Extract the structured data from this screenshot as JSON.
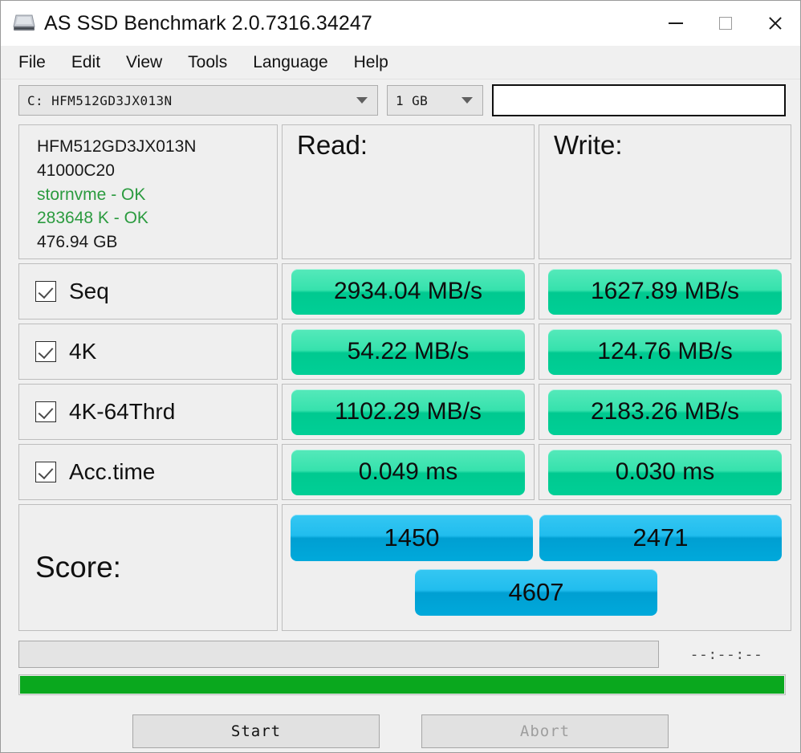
{
  "window": {
    "title": "AS SSD Benchmark 2.0.7316.34247",
    "icon": "ssd-drive-icon",
    "minimize": "minimize-icon",
    "maximize": "maximize-icon",
    "close": "close-icon"
  },
  "menu": {
    "items": [
      "File",
      "Edit",
      "View",
      "Tools",
      "Language",
      "Help"
    ]
  },
  "toolbar": {
    "drive": "C: HFM512GD3JX013N",
    "size": "1 GB",
    "info_field_value": ""
  },
  "drive_info": {
    "model": "HFM512GD3JX013N",
    "firmware": "41000C20",
    "driver": "stornvme - OK",
    "alignment": "283648 K - OK",
    "capacity": "476.94 GB"
  },
  "columns": {
    "read": "Read:",
    "write": "Write:"
  },
  "tests": [
    {
      "name": "Seq",
      "checked": true,
      "read": "2934.04 MB/s",
      "write": "1627.89 MB/s"
    },
    {
      "name": "4K",
      "checked": true,
      "read": "54.22 MB/s",
      "write": "124.76 MB/s"
    },
    {
      "name": "4K-64Thrd",
      "checked": true,
      "read": "1102.29 MB/s",
      "write": "2183.26 MB/s"
    },
    {
      "name": "Acc.time",
      "checked": true,
      "read": "0.049 ms",
      "write": "0.030 ms"
    }
  ],
  "score": {
    "label": "Score:",
    "read": "1450",
    "write": "2471",
    "total": "4607"
  },
  "status": {
    "message": "",
    "timer": "--:--:--",
    "progress_percent": 100
  },
  "buttons": {
    "start": "Start",
    "abort": "Abort"
  },
  "colors": {
    "result_green": "#00c990",
    "score_blue": "#00a9db",
    "progress_green": "#0aa81e",
    "ok_text": "#2b9b3f"
  }
}
